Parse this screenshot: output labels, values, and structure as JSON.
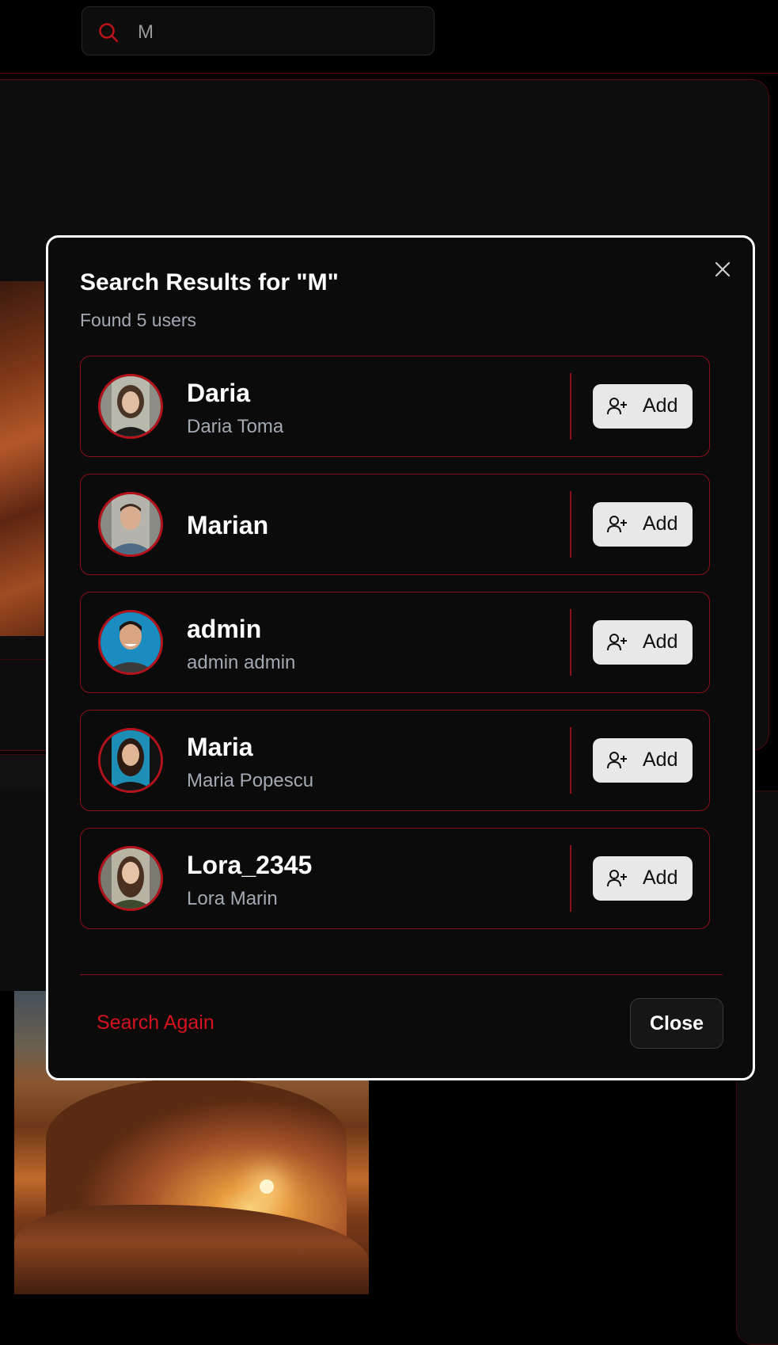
{
  "search": {
    "query": "M"
  },
  "modal": {
    "title": "Search Results for \"M\"",
    "subtitle": "Found 5 users",
    "results": [
      {
        "username": "Daria",
        "full_name": "Daria Toma",
        "add_label": "Add"
      },
      {
        "username": "Marian",
        "full_name": "",
        "add_label": "Add"
      },
      {
        "username": "admin",
        "full_name": "admin admin",
        "add_label": "Add"
      },
      {
        "username": "Maria",
        "full_name": "Maria Popescu",
        "add_label": "Add"
      },
      {
        "username": "Lora_2345",
        "full_name": "Lora Marin",
        "add_label": "Add"
      }
    ],
    "search_again_label": "Search Again",
    "close_label": "Close"
  },
  "colors": {
    "accent": "#d4131e",
    "border_red": "#8b1019",
    "background": "#000000",
    "panel": "#0b0b0b"
  }
}
